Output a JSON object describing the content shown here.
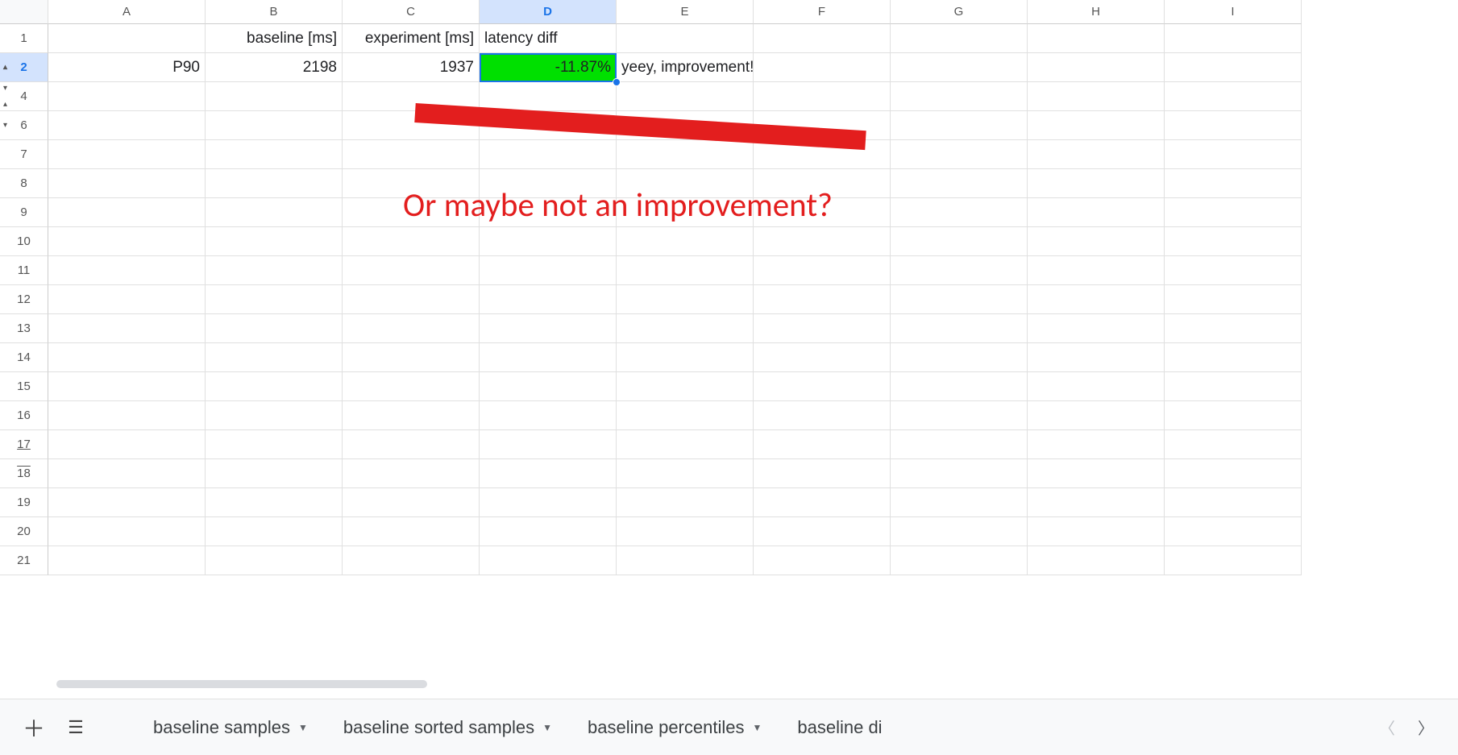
{
  "columns": [
    "A",
    "B",
    "C",
    "D",
    "E",
    "F",
    "G",
    "H",
    "I"
  ],
  "selected_column": "D",
  "row_numbers": [
    "1",
    "2",
    "4",
    "6",
    "7",
    "8",
    "9",
    "10",
    "11",
    "12",
    "13",
    "14",
    "15",
    "16",
    "17",
    "18",
    "19",
    "20",
    "21"
  ],
  "selected_row": "2",
  "headers": {
    "B": "baseline [ms]",
    "C": "experiment [ms]",
    "D": "latency diff"
  },
  "data_row": {
    "A": "P90",
    "B": "2198",
    "C": "1937",
    "D": "-11.87%",
    "E": "yeey, improvement!"
  },
  "annotation_text": "Or maybe not an improvement?",
  "sheet_tabs": [
    "baseline samples",
    "baseline sorted samples",
    "baseline percentiles",
    "baseline di"
  ],
  "colors": {
    "highlight_green": "#00e000",
    "selection_blue": "#1a73e8",
    "annotation_red": "#e31e1e"
  }
}
